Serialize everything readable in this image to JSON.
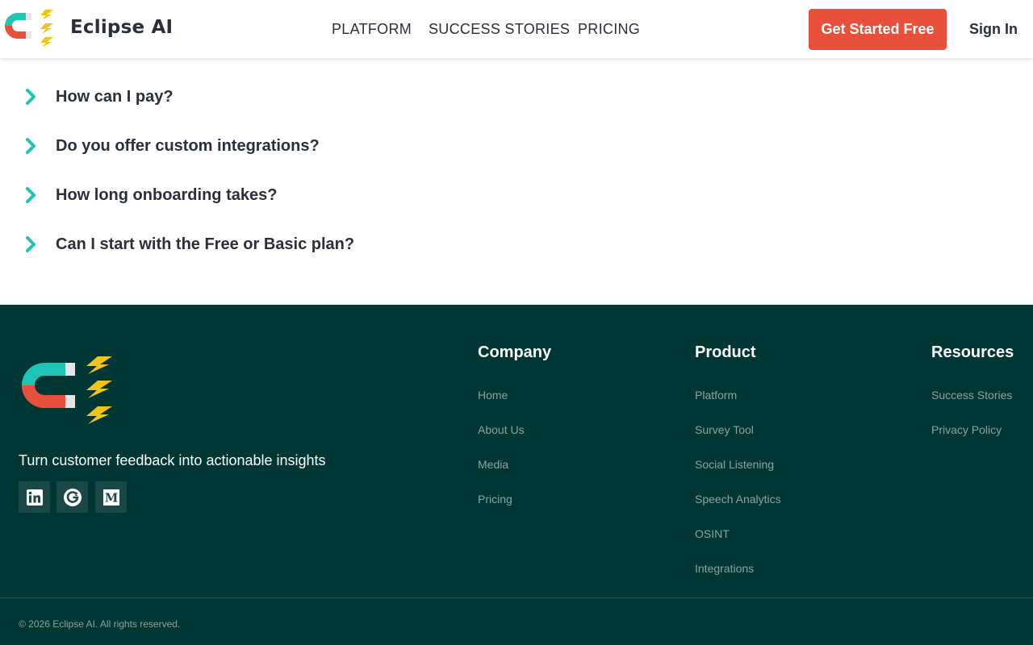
{
  "brand": {
    "name": "Eclipse AI",
    "colors": {
      "teal": "#1ec4b4",
      "red": "#e8503b",
      "yellow": "#f0c419",
      "footer_bg": "#003634"
    }
  },
  "header": {
    "nav": [
      "PLATFORM",
      "SUCCESS STORIES",
      "PRICING"
    ],
    "cta_label": "Get Started Free",
    "signin_label": "Sign In"
  },
  "faq": [
    {
      "question": "How can I pay?"
    },
    {
      "question": "Do you offer custom integrations?"
    },
    {
      "question": "How long onboarding takes?"
    },
    {
      "question": "Can I start with the Free or Basic plan?"
    }
  ],
  "footer": {
    "tagline": "Turn customer feedback into actionable insights",
    "social": [
      "linkedin-icon",
      "g2-icon",
      "medium-icon"
    ],
    "company": {
      "heading": "Company",
      "links": [
        "Home",
        "About Us",
        "Media",
        "Pricing"
      ]
    },
    "product": {
      "heading": "Product",
      "links": [
        "Platform",
        "Survey Tool",
        "Social Listening",
        "Speech Analytics",
        "OSINT",
        "Integrations"
      ]
    },
    "resources": {
      "heading": "Resources",
      "links": [
        "Success Stories",
        "Privacy Policy"
      ]
    },
    "copyright": "© 2026 Eclipse AI. All rights reserved."
  }
}
